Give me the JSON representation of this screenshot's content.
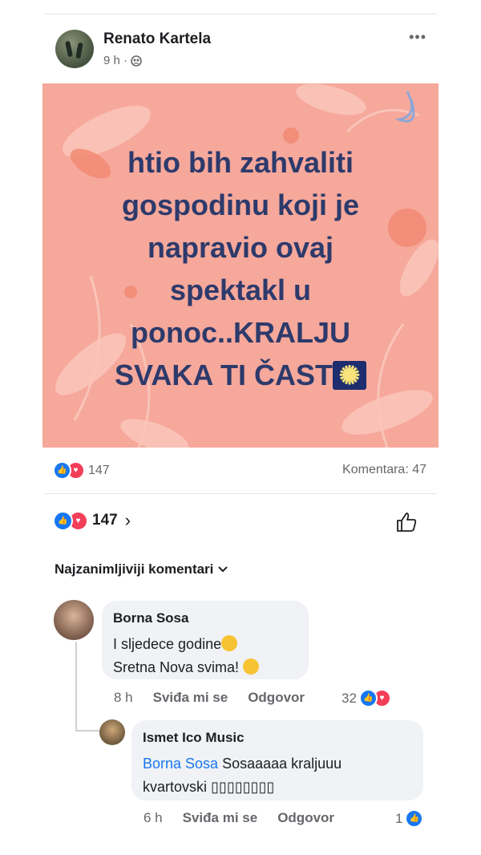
{
  "post": {
    "author": "Renato Kartela",
    "time": "9 h ·",
    "privacy_icon": "friends-icon",
    "more_icon": "•••",
    "image_text_lines": [
      "htio bih zahvaliti",
      "gospodinu koji je",
      "napravio ovaj",
      "spektakl u",
      "ponoc..KRALJU",
      "SVAKA TI ČAST"
    ],
    "background_color": "#f6a89b",
    "text_color": "#2d3a6b"
  },
  "reactions": {
    "count": "147",
    "comments_label": "Komentara: 47"
  },
  "reactions_bar": {
    "count": "147",
    "chevron": "›"
  },
  "comments_sort": {
    "label": "Najzanimljiviji komentari"
  },
  "comments": [
    {
      "name": "Borna Sosa",
      "line1": "I sljedece godine",
      "line2": "Sretna Nova svima!",
      "time": "8 h",
      "like_label": "Sviđa mi se",
      "reply_label": "Odgovor",
      "reaction_count": "32"
    }
  ],
  "replies": [
    {
      "name": "Ismet Ico Music",
      "mention": "Borna Sosa",
      "text_rest": " Sosaaaaa  kraljuuu",
      "line2": "kvartovski ▯▯▯▯▯▯▯▯",
      "time": "6 h",
      "like_label": "Sviđa mi se",
      "reply_label": "Odgovor",
      "reaction_count": "1"
    }
  ]
}
